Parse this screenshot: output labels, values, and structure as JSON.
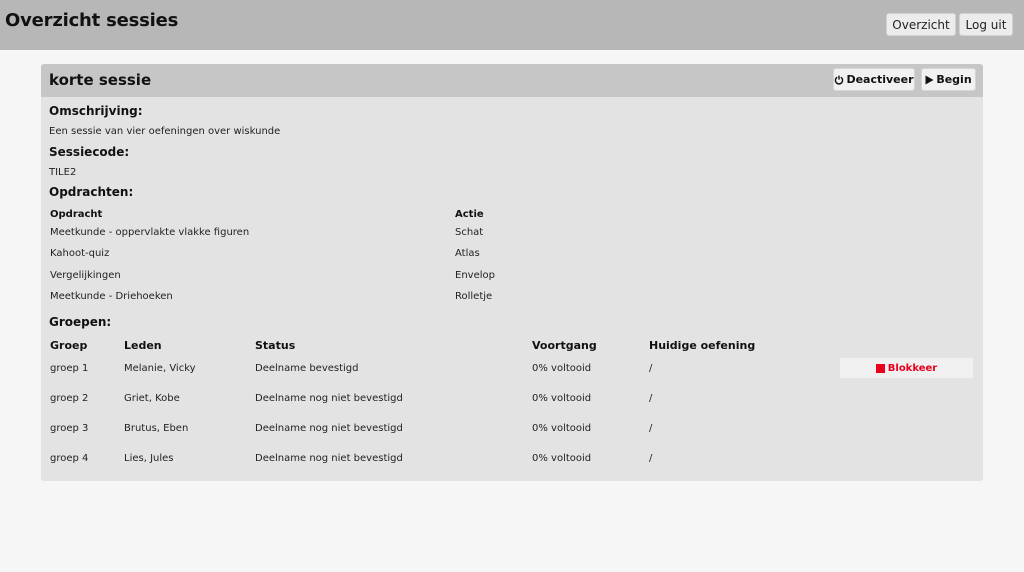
{
  "header": {
    "title": "Overzicht sessies",
    "overzicht_label": "Overzicht",
    "logout_label": "Log uit"
  },
  "session": {
    "title": "korte sessie",
    "deactivate_label": "Deactiveer",
    "begin_label": "Begin",
    "description_heading": "Omschrijving:",
    "description": "Een sessie van vier oefeningen over wiskunde",
    "code_heading": "Sessiecode:",
    "code": "TILE2",
    "assignments_heading": "Opdrachten:",
    "assignments_columns": [
      "Opdracht",
      "Actie"
    ],
    "assignments": [
      {
        "opdracht": "Meetkunde - oppervlakte vlakke figuren",
        "actie": "Schat"
      },
      {
        "opdracht": "Kahoot-quiz",
        "actie": "Atlas"
      },
      {
        "opdracht": "Vergelijkingen",
        "actie": "Envelop"
      },
      {
        "opdracht": "Meetkunde - Driehoeken",
        "actie": "Rolletje"
      }
    ],
    "groups_heading": "Groepen:",
    "groups_columns": [
      "Groep",
      "Leden",
      "Status",
      "Voortgang",
      "Huidige oefening"
    ],
    "groups": [
      {
        "groep": "groep 1",
        "leden": "Melanie, Vicky",
        "status": "Deelname bevestigd",
        "voortgang": "0% voltooid",
        "oefening": "/"
      },
      {
        "groep": "groep 2",
        "leden": "Griet, Kobe",
        "status": "Deelname nog niet bevestigd",
        "voortgang": "0% voltooid",
        "oefening": "/"
      },
      {
        "groep": "groep 3",
        "leden": "Brutus, Eben",
        "status": "Deelname nog niet bevestigd",
        "voortgang": "0% voltooid",
        "oefening": "/"
      },
      {
        "groep": "groep 4",
        "leden": "Lies, Jules",
        "status": "Deelname nog niet bevestigd",
        "voortgang": "0% voltooid",
        "oefening": "/"
      }
    ],
    "block_label": "Blokkeer"
  },
  "icons": {
    "deactivate": "power-icon",
    "begin": "play-icon",
    "block": "stop-square-icon"
  },
  "colors": {
    "block_accent": "#e8001c",
    "topbar": "#b7b7b7",
    "card_header": "#c6c6c6",
    "card_body": "#e3e3e3"
  }
}
